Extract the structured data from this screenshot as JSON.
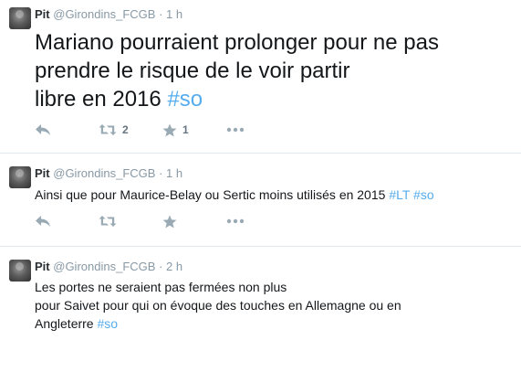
{
  "tweets": [
    {
      "name": "Pit",
      "handle": "@Girondins_FCGB",
      "separator": "·",
      "time": "1 h",
      "text_parts": [
        "Mariano pourraient prolonger pour ne pas",
        "prendre le risque de le voir partir",
        "libre en 2016 "
      ],
      "hashtags": [
        "#so"
      ],
      "retweets": "2",
      "favorites": "1"
    },
    {
      "name": "Pit",
      "handle": "@Girondins_FCGB",
      "separator": "·",
      "time": "1 h",
      "text": "Ainsi que pour Maurice-Belay ou Sertic moins utilisés en 2015 ",
      "hashtags": [
        "#LT",
        "#so"
      ]
    },
    {
      "name": "Pit",
      "handle": "@Girondins_FCGB",
      "separator": "·",
      "time": "2 h",
      "text_parts": [
        "Les portes ne seraient pas fermées non plus",
        "pour Saivet pour qui on évoque des touches en Allemagne ou en",
        "Angleterre "
      ],
      "hashtags": [
        "#so"
      ]
    }
  ],
  "icons": {
    "reply": "reply-icon",
    "retweet": "retweet-icon",
    "favorite": "star-icon",
    "more": "more-icon"
  },
  "colors": {
    "hashtag": "#55acee",
    "meta": "#8899a6",
    "icon": "#99aab5",
    "divider": "#e1e8ed"
  }
}
